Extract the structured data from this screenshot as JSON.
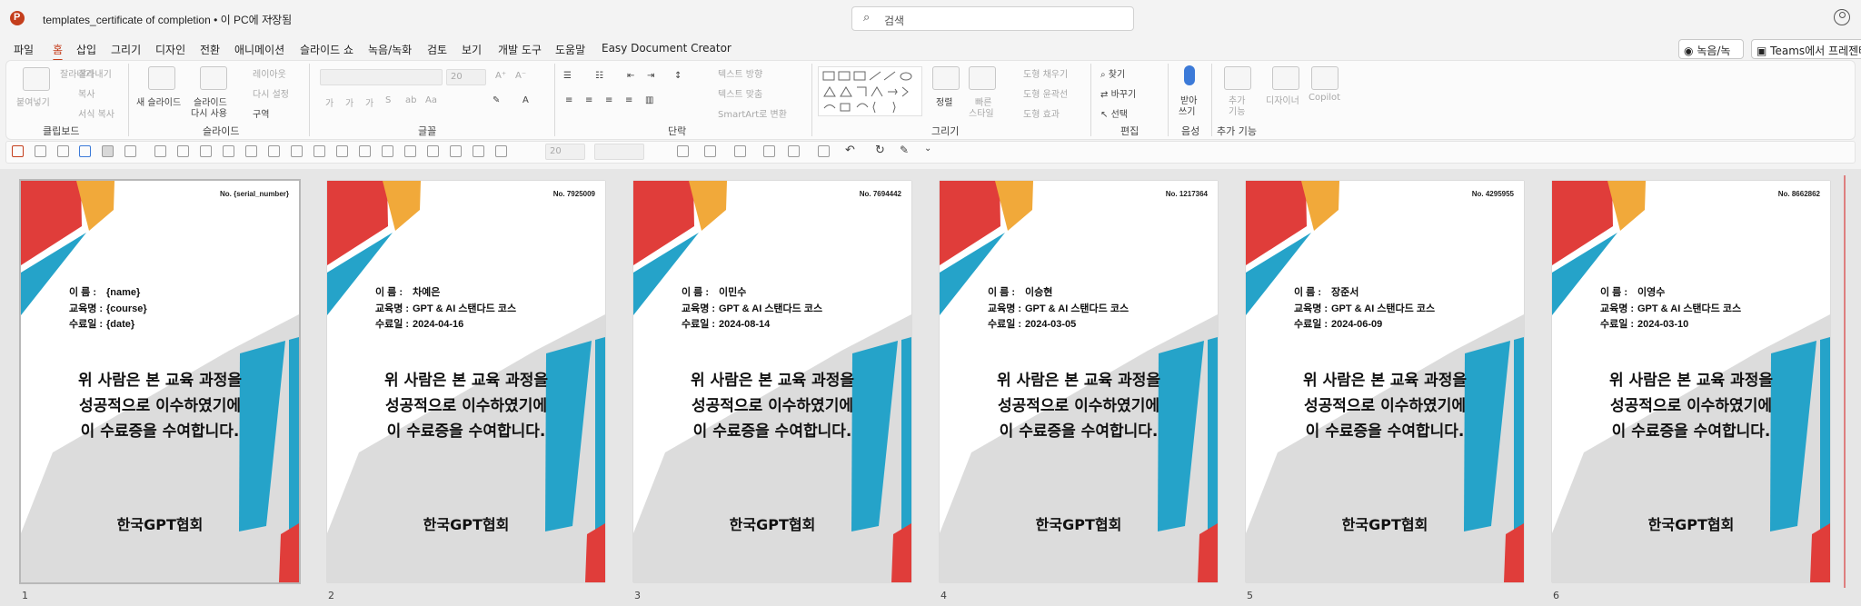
{
  "titlebar": {
    "doc_title": "templates_certificate of completion • 이 PC에 저장됨",
    "chevron": "⌄",
    "search_placeholder": "검색",
    "search_icon": "search-icon",
    "user_icon": "user-icon"
  },
  "menu": {
    "tabs": [
      "파일",
      "홈",
      "삽입",
      "그리기",
      "디자인",
      "전환",
      "애니메이션",
      "슬라이드 쇼",
      "녹음/녹화",
      "검토",
      "보기",
      "개발 도구",
      "도움말",
      "Easy Document Creator"
    ],
    "active_tab": "홈",
    "record_button": "녹음/녹화",
    "teams_button": "Teams에서 프레젠테"
  },
  "ribbon": {
    "groups": [
      "클립보드",
      "슬라이드",
      "글꼴",
      "단락",
      "그리기",
      "편집",
      "음성",
      "추가 기능"
    ],
    "clipboard": {
      "paste": "붙여넣기",
      "cut": "잘라내기",
      "copy": "복사",
      "format_painter": "서식 복사"
    },
    "slides": {
      "new_slide": "새 슬라이드",
      "reuse_slide_1": "슬라이드",
      "reuse_slide_2": "다시 사용",
      "layout": "레이아웃",
      "reset": "다시 설정",
      "section": "구역"
    },
    "font": {
      "font_size": "20"
    },
    "paragraph": {
      "text_direction": "텍스트 방향",
      "align_text": "텍스트 맞춤",
      "smartart": "SmartArt로 변환"
    },
    "drawing": {
      "arrange": "정렬",
      "quick_styles_1": "빠른",
      "quick_styles_2": "스타일",
      "shape_fill": "도형 채우기",
      "shape_outline": "도형 윤곽선",
      "shape_effects": "도형 효과"
    },
    "editing": {
      "find": "찾기",
      "replace": "바꾸기",
      "select": "선택"
    },
    "voice": {
      "dictate_1": "받아",
      "dictate_2": "쓰기"
    },
    "addins": {
      "add_1": "추가",
      "add_2": "기능",
      "designer": "디자이너",
      "copilot": "Copilot"
    }
  },
  "qat": {
    "font_size": "20"
  },
  "colors": {
    "accent": "#c43e1c",
    "red": "#e03d3a",
    "orange": "#f1a93a",
    "blue": "#25a3c9",
    "gray": "#dcdcdc"
  },
  "slides": [
    {
      "number": "1",
      "serial": "No. {serial_number}",
      "name": "{name}",
      "course": "{course}",
      "date": "{date}"
    },
    {
      "number": "2",
      "serial": "No. 7925009",
      "name": "차예은",
      "course": "GPT & AI 스탠다드 코스",
      "date": "2024-04-16"
    },
    {
      "number": "3",
      "serial": "No. 7694442",
      "name": "이민수",
      "course": "GPT & AI 스탠다드 코스",
      "date": "2024-08-14"
    },
    {
      "number": "4",
      "serial": "No. 1217364",
      "name": "이승현",
      "course": "GPT & AI 스탠다드 코스",
      "date": "2024-03-05"
    },
    {
      "number": "5",
      "serial": "No. 4295955",
      "name": "장준서",
      "course": "GPT & AI 스탠다드 코스",
      "date": "2024-06-09"
    },
    {
      "number": "6",
      "serial": "No. 8662862",
      "name": "이영수",
      "course": "GPT & AI 스탠다드 코스",
      "date": "2024-03-10"
    }
  ],
  "certificate": {
    "label_name": "이 름 :",
    "label_course": "교육명 :",
    "label_date": "수료일 :",
    "message_1": "위 사람은 본 교육 과정을",
    "message_2": "성공적으로 이수하였기에",
    "message_3": "이 수료증을 수여합니다.",
    "organization": "한국GPT협회"
  }
}
